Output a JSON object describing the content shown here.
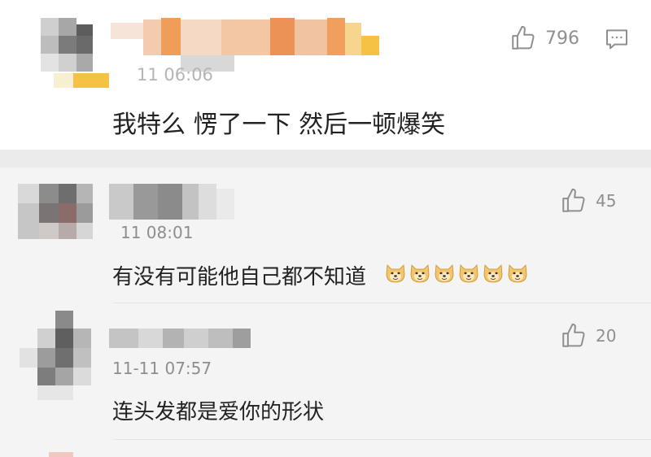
{
  "main_comment": {
    "timestamp": "11 06:06",
    "text": "我特么 愣了一下 然后一顿爆笑",
    "likes": "796",
    "like_icon": "thumbs-up-icon",
    "reply_icon": "comment-bubble-icon"
  },
  "replies": [
    {
      "timestamp": "11 08:01",
      "text": "有没有可能他自己都不知道",
      "emoji": "doge-emoji",
      "emoji_count": 6,
      "likes": "45",
      "like_icon": "thumbs-up-icon"
    },
    {
      "timestamp": "11-11 07:57",
      "text": "连头发都是爱你的形状",
      "likes": "20",
      "like_icon": "thumbs-up-icon"
    }
  ],
  "colors": {
    "mosaic_orange": "#f0a05c",
    "mosaic_yellow": "#f5c245",
    "text": "#222222",
    "meta": "#9a9a9a"
  }
}
